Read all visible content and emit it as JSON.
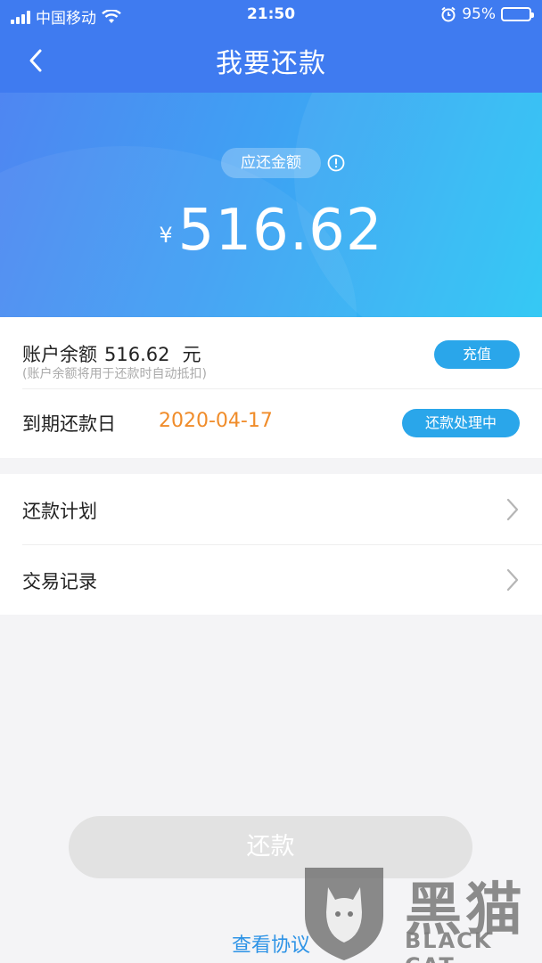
{
  "status_bar": {
    "carrier": "中国移动",
    "time": "21:50",
    "battery": "95%",
    "battery_level": 0.95
  },
  "nav": {
    "title": "我要还款"
  },
  "hero": {
    "label": "应还金额",
    "currency": "¥",
    "amount": "516.62"
  },
  "account": {
    "balance_label": "账户余额",
    "balance_value": "516.62",
    "balance_unit": "元",
    "balance_note": "(账户余额将用于还款时自动抵扣)",
    "recharge_label": "充值",
    "due_label": "到期还款日",
    "due_date": "2020-04-17",
    "status_label": "还款处理中"
  },
  "menu": {
    "items": [
      {
        "label": "还款计划"
      },
      {
        "label": "交易记录"
      }
    ]
  },
  "footer": {
    "repay_label": "还款",
    "agreement_label": "查看协议"
  },
  "watermark": {
    "cn": "黑猫",
    "en": "BLACK CAT"
  },
  "colors": {
    "nav_bg": "#3f7bf0",
    "accent_blue": "#2aa6ea",
    "date_orange": "#f08c2a",
    "link_blue": "#2d93e6",
    "disabled_btn": "#e2e2e2"
  }
}
